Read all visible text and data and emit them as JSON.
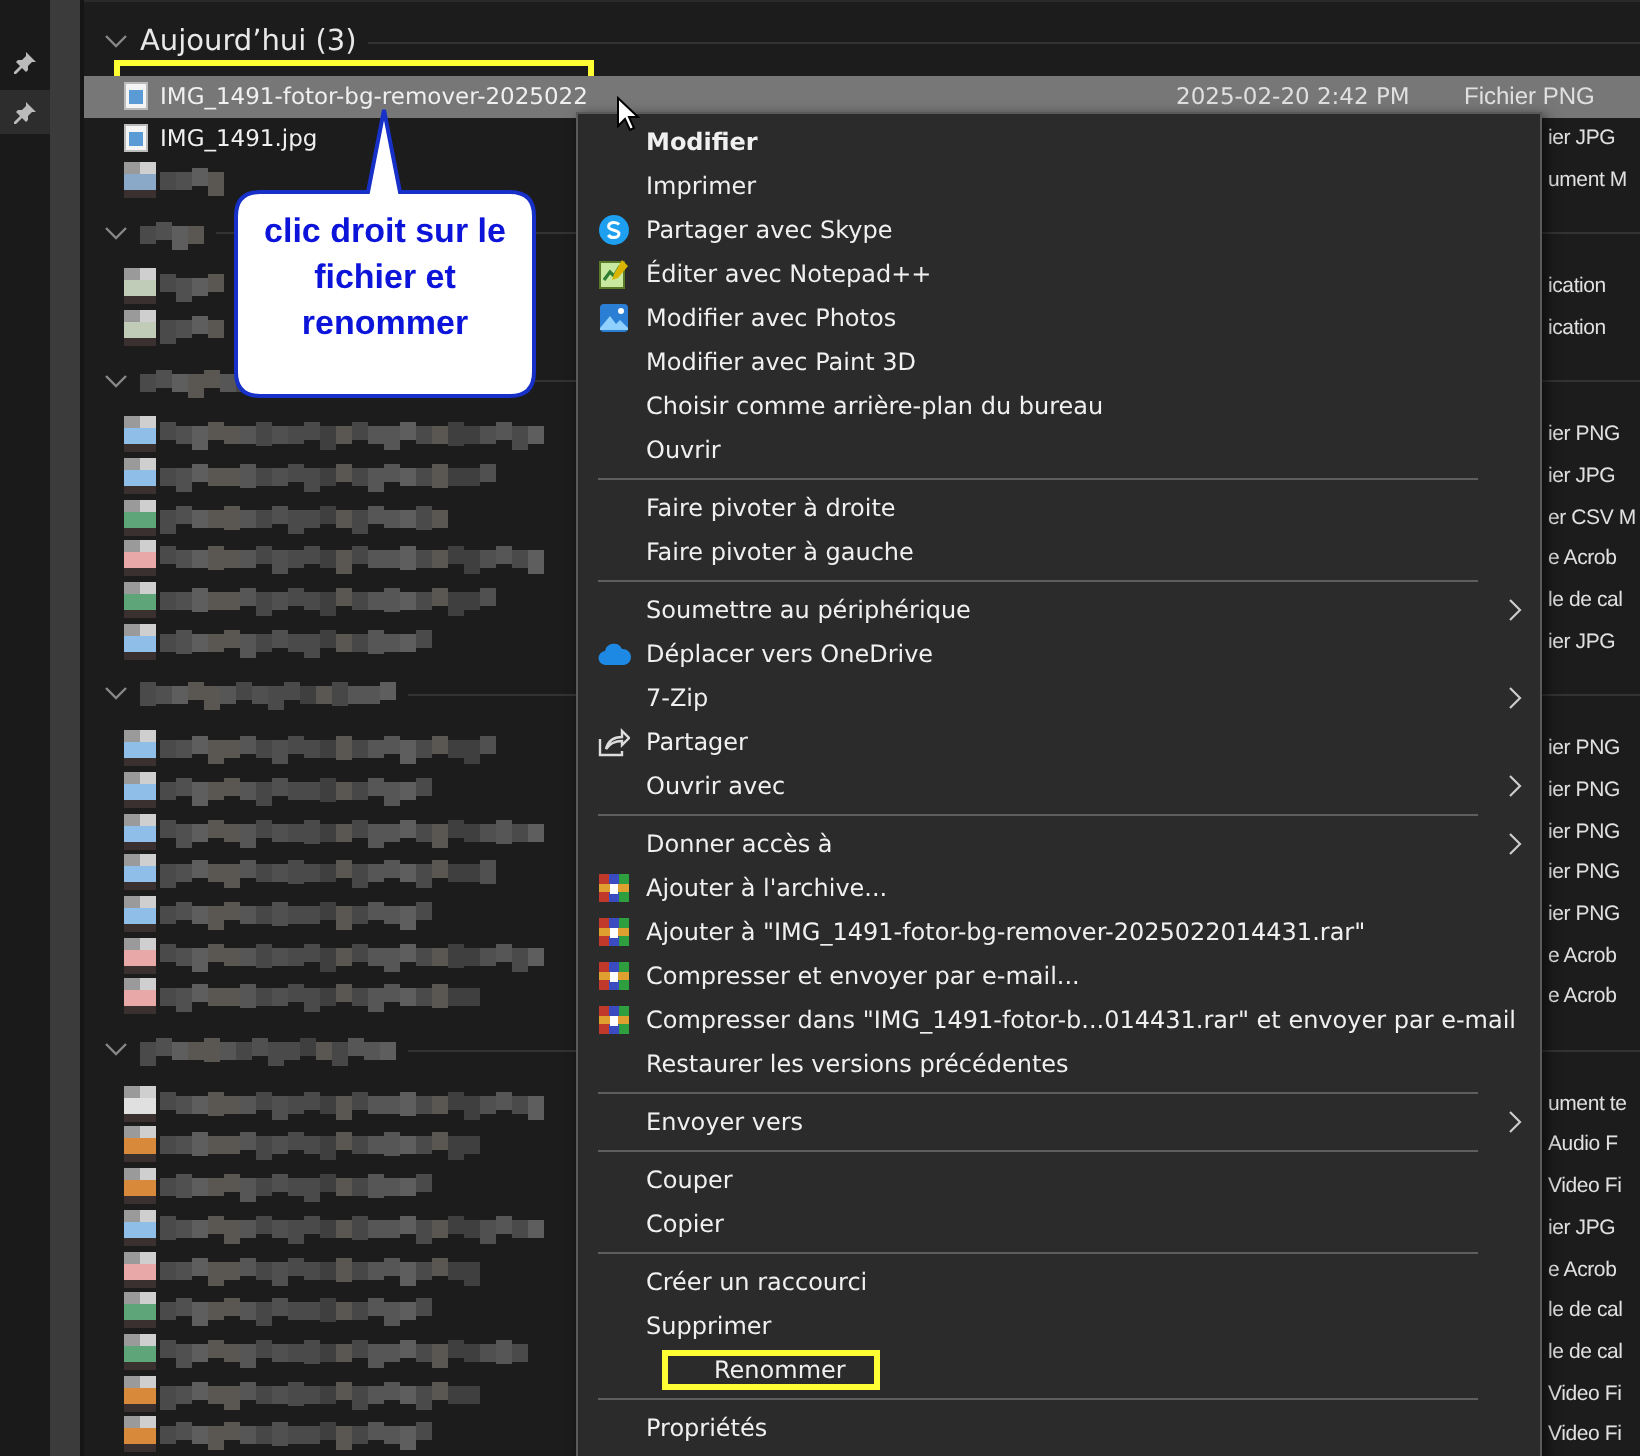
{
  "groups": [
    {
      "header": {
        "kind": "text",
        "label": "Aujourd’hui (3)"
      },
      "rows": [
        {
          "kind": "file",
          "selected": true,
          "highlighted": true,
          "color": "#5b9bd5",
          "name": "IMG_1491-fotor-bg-remover-2025022",
          "date": "2025-02-20 2:42 PM",
          "type": "Fichier PNG"
        },
        {
          "kind": "file",
          "selected": false,
          "highlighted": false,
          "color": "#5b9bd5",
          "name": "IMG_1491.jpg",
          "type": "ier JPG"
        },
        {
          "kind": "blurred",
          "color": "#8aa8c8",
          "type": "ument M"
        }
      ]
    },
    {
      "header": {
        "kind": "blurred"
      },
      "rows": [
        {
          "kind": "blurred",
          "color": "#c0cbb8",
          "type": "ication"
        },
        {
          "kind": "blurred",
          "color": "#c0cbb8",
          "type": "ication"
        }
      ]
    },
    {
      "header": {
        "kind": "blurred"
      },
      "rows": [
        {
          "kind": "blurred",
          "color": "#8fbfe8",
          "type": "ier PNG"
        },
        {
          "kind": "blurred",
          "color": "#8fbfe8",
          "type": "ier JPG"
        },
        {
          "kind": "blurred",
          "color": "#5fa57a",
          "type": "er CSV M"
        },
        {
          "kind": "blurred",
          "color": "#e8a8a8",
          "type": "e Acrob"
        },
        {
          "kind": "blurred",
          "color": "#5fa57a",
          "type": "le de cal"
        },
        {
          "kind": "blurred",
          "color": "#8fbfe8",
          "type": "ier JPG"
        }
      ]
    },
    {
      "header": {
        "kind": "blurred"
      },
      "rows": [
        {
          "kind": "blurred",
          "color": "#8fbfe8",
          "type": "ier PNG"
        },
        {
          "kind": "blurred",
          "color": "#8fbfe8",
          "type": "ier PNG"
        },
        {
          "kind": "blurred",
          "color": "#8fbfe8",
          "type": "ier PNG"
        },
        {
          "kind": "blurred",
          "color": "#8fbfe8",
          "type": "ier PNG"
        },
        {
          "kind": "blurred",
          "color": "#8fbfe8",
          "type": "ier PNG"
        },
        {
          "kind": "blurred",
          "color": "#e8a8a8",
          "type": "e Acrob"
        },
        {
          "kind": "blurred",
          "color": "#e8a8a8",
          "type": "e Acrob"
        }
      ]
    },
    {
      "header": {
        "kind": "blurred"
      },
      "rows": [
        {
          "kind": "blurred",
          "color": "#e0e0e0",
          "type": "ument te"
        },
        {
          "kind": "blurred",
          "color": "#d88a3a",
          "type": "Audio F"
        },
        {
          "kind": "blurred",
          "color": "#d88a3a",
          "type": "Video Fi"
        },
        {
          "kind": "blurred",
          "color": "#8fbfe8",
          "type": "ier JPG"
        },
        {
          "kind": "blurred",
          "color": "#e8a8a8",
          "type": "e Acrob"
        },
        {
          "kind": "blurred",
          "color": "#5fa57a",
          "type": "le de cal"
        },
        {
          "kind": "blurred",
          "color": "#5fa57a",
          "type": "le de cal"
        },
        {
          "kind": "blurred",
          "color": "#d88a3a",
          "type": "Video Fi"
        },
        {
          "kind": "blurred",
          "color": "#d88a3a",
          "type": "Video Fi"
        }
      ]
    }
  ],
  "callout": {
    "text": "clic droit sur le fichier et renommer"
  },
  "context_menu": [
    {
      "kind": "item",
      "label": "Modifier",
      "bold": true
    },
    {
      "kind": "item",
      "label": "Imprimer"
    },
    {
      "kind": "skype",
      "label": "Partager avec Skype"
    },
    {
      "kind": "notepad",
      "label": "Éditer avec Notepad++"
    },
    {
      "kind": "photos",
      "label": "Modifier avec Photos"
    },
    {
      "kind": "item",
      "label": "Modifier avec Paint 3D"
    },
    {
      "kind": "item",
      "label": "Choisir comme arrière-plan du bureau"
    },
    {
      "kind": "item",
      "label": "Ouvrir"
    },
    {
      "kind": "separator"
    },
    {
      "kind": "item",
      "label": "Faire pivoter à droite"
    },
    {
      "kind": "item",
      "label": "Faire pivoter à gauche"
    },
    {
      "kind": "separator"
    },
    {
      "kind": "item",
      "label": "Soumettre au périphérique",
      "submenu": true
    },
    {
      "kind": "cloud",
      "label": "Déplacer vers OneDrive"
    },
    {
      "kind": "item",
      "label": "7-Zip",
      "submenu": true
    },
    {
      "kind": "share",
      "label": "Partager"
    },
    {
      "kind": "item",
      "label": "Ouvrir avec",
      "submenu": true
    },
    {
      "kind": "separator"
    },
    {
      "kind": "item",
      "label": "Donner accès à",
      "submenu": true
    },
    {
      "kind": "archive",
      "label": "Ajouter à l'archive..."
    },
    {
      "kind": "archive",
      "label": "Ajouter à \"IMG_1491-fotor-bg-remover-2025022014431.rar\""
    },
    {
      "kind": "archive",
      "label": "Compresser et envoyer par e-mail..."
    },
    {
      "kind": "archive",
      "label": "Compresser dans \"IMG_1491-fotor-b...014431.rar\" et envoyer par e-mail"
    },
    {
      "kind": "item",
      "label": "Restaurer les versions précédentes"
    },
    {
      "kind": "separator"
    },
    {
      "kind": "item",
      "label": "Envoyer vers",
      "submenu": true
    },
    {
      "kind": "separator"
    },
    {
      "kind": "item",
      "label": "Couper"
    },
    {
      "kind": "item",
      "label": "Copier"
    },
    {
      "kind": "separator"
    },
    {
      "kind": "item",
      "label": "Créer un raccourci"
    },
    {
      "kind": "item",
      "label": "Supprimer"
    },
    {
      "kind": "item",
      "label": "Renommer",
      "highlighted": true
    },
    {
      "kind": "separator"
    },
    {
      "kind": "item",
      "label": "Propriétés"
    }
  ]
}
